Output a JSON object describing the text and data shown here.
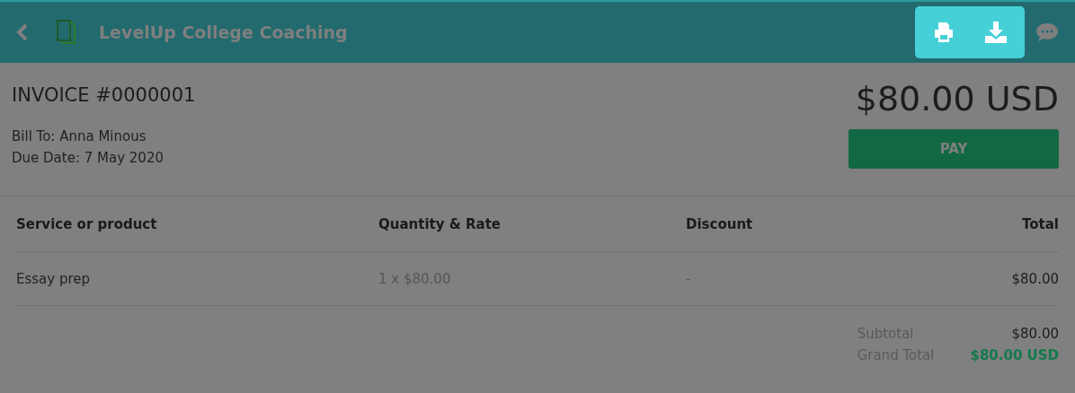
{
  "header": {
    "title": "LevelUp College Coaching"
  },
  "invoice": {
    "number": "INVOICE #0000001",
    "bill_to": "Bill To: Anna Minous",
    "due_date": "Due Date: 7 May 2020",
    "amount": "$80.00 USD",
    "pay_button": "PAY"
  },
  "table": {
    "columns": [
      "Service or product",
      "Quantity & Rate",
      "Discount",
      "Total"
    ],
    "rows": [
      [
        "Essay prep",
        "1 x $80.00",
        "-",
        "$80.00"
      ]
    ]
  },
  "totals": [
    {
      "label": "Subtotal",
      "value": "$80.00",
      "kind": "plain"
    },
    {
      "label": "Grand Total",
      "value": "$80.00 USD",
      "kind": "grand"
    }
  ]
}
